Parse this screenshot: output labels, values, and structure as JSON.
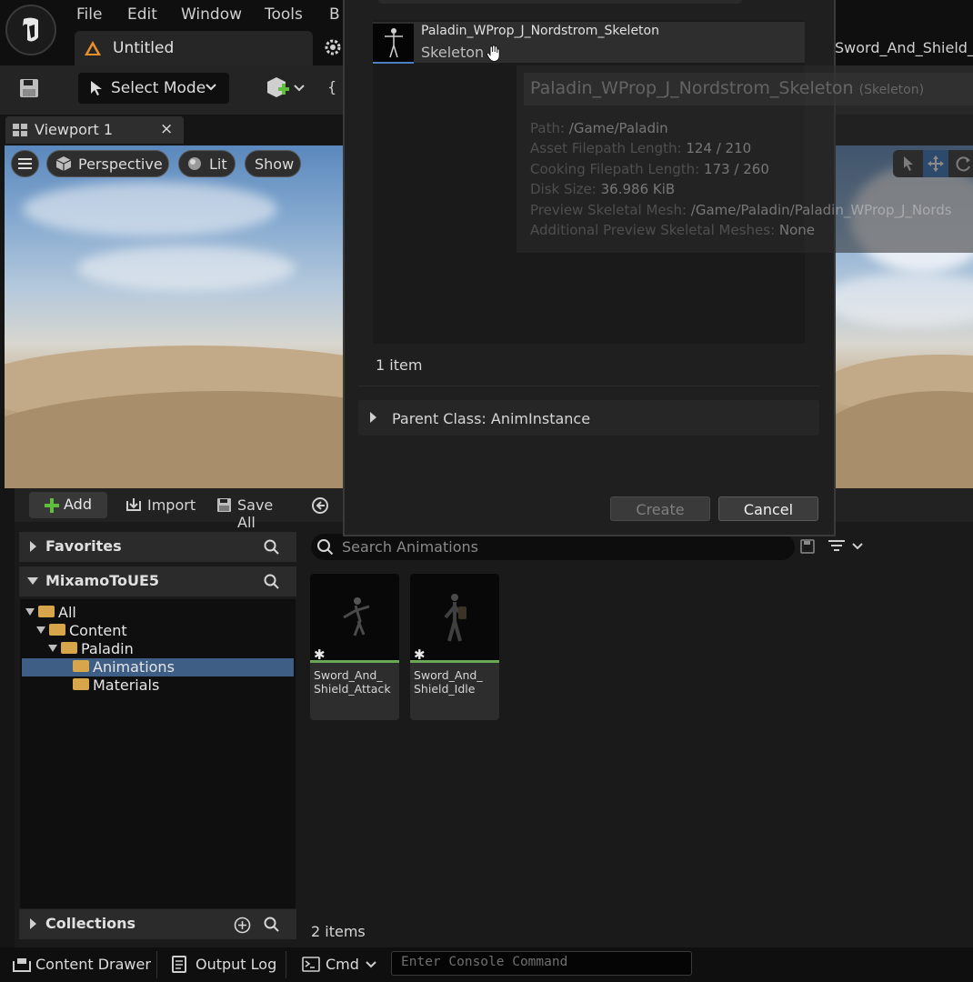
{
  "menu": {
    "file": "File",
    "edit": "Edit",
    "window": "Window",
    "tools": "Tools",
    "build_partial": "B"
  },
  "tabs": {
    "level": "Untitled",
    "asset": "Sword_And_Shield_"
  },
  "toolbar": {
    "select_mode": "Select Mode"
  },
  "viewport": {
    "tab_label": "Viewport 1",
    "perspective": "Perspective",
    "lit": "Lit",
    "show": "Show"
  },
  "content_browser": {
    "add": "Add",
    "import": "Import",
    "save_all": "Save All",
    "favorites": "Favorites",
    "project": "MixamoToUE5",
    "collections": "Collections",
    "tree": [
      {
        "label": "All"
      },
      {
        "label": "Content"
      },
      {
        "label": "Paladin"
      },
      {
        "label": "Animations"
      },
      {
        "label": "Materials"
      }
    ],
    "search_placeholder": "Search Animations",
    "assets": [
      {
        "name": "Sword_And_\nShield_Attack"
      },
      {
        "name": "Sword_And_\nShield_Idle"
      }
    ],
    "item_count": "2 items"
  },
  "status_bar": {
    "content_drawer": "Content Drawer",
    "output_log": "Output Log",
    "cmd": "Cmd",
    "console_placeholder": "Enter Console Command"
  },
  "dialog": {
    "skeleton_name": "Paladin_WProp_J_Nordstrom_Skeleton",
    "skeleton_type": "Skeleton",
    "tooltip": {
      "title": "Paladin_WProp_J_Nordstrom_Skeleton",
      "title_type": "(Skeleton)",
      "rows": [
        {
          "key": "Path:",
          "value": "/Game/Paladin"
        },
        {
          "key": "Asset Filepath Length:",
          "value": "124 / 210"
        },
        {
          "key": "Cooking Filepath Length:",
          "value": "173 / 260"
        },
        {
          "key": "Disk Size:",
          "value": "36.986 KiB"
        },
        {
          "key": "Preview Skeletal Mesh:",
          "value": "/Game/Paladin/Paladin_WProp_J_Nords"
        },
        {
          "key": "Additional Preview Skeletal Meshes:",
          "value": "None"
        }
      ]
    },
    "item_count": "1 item",
    "parent_class": "Parent Class: AnimInstance",
    "create": "Create",
    "cancel": "Cancel"
  }
}
